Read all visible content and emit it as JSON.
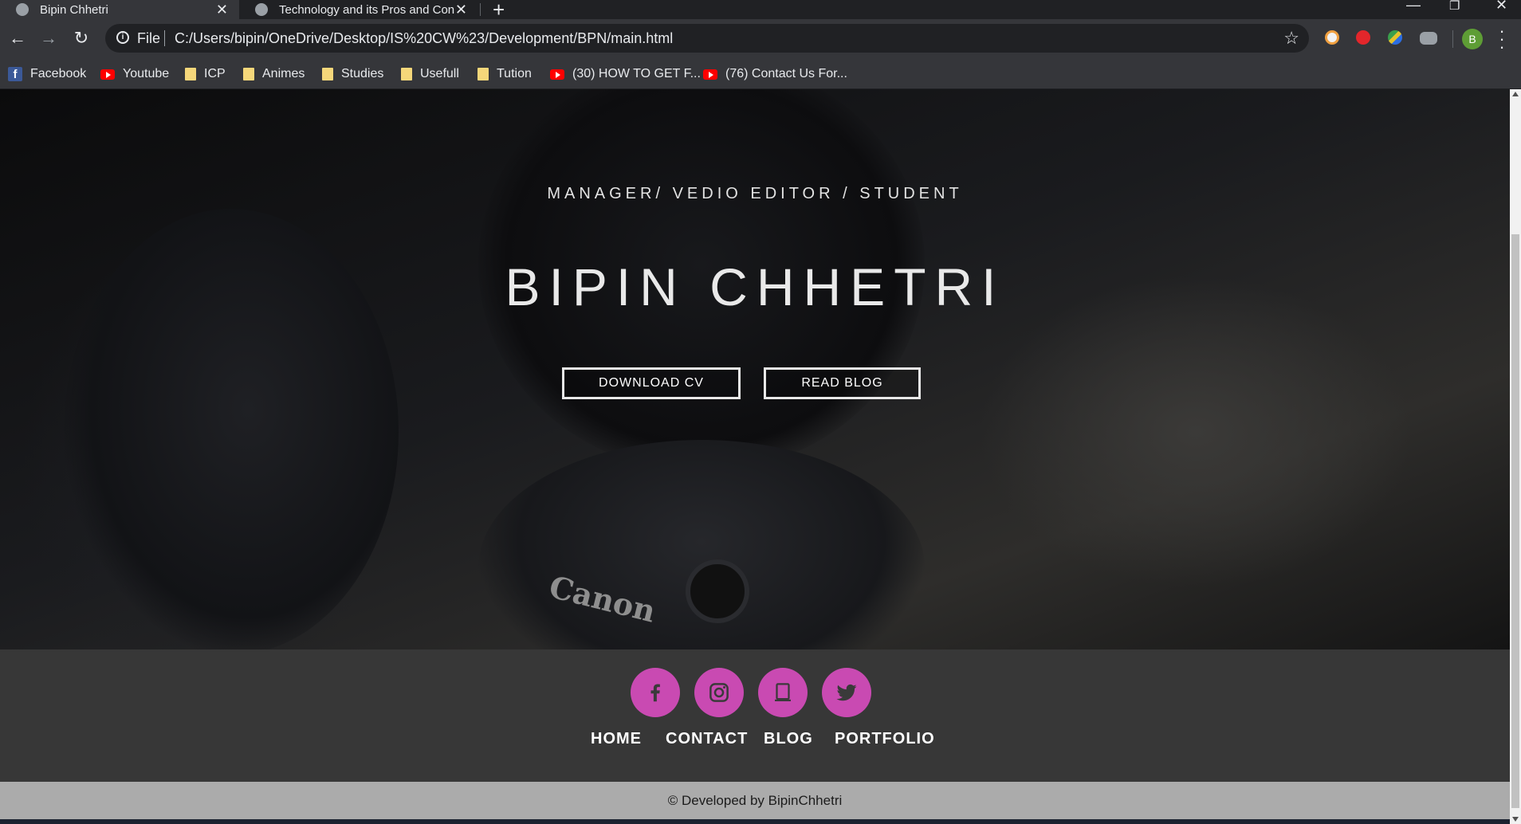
{
  "browser": {
    "tabs": [
      {
        "title": "Bipin Chhetri",
        "active": true
      },
      {
        "title": "Technology and its Pros and Cons",
        "active": false
      }
    ],
    "new_tab_label": "+",
    "window_controls": {
      "minimize": "—",
      "restore": "❐",
      "close": "✕"
    },
    "address": {
      "scheme": "File",
      "url": "C:/Users/bipin/OneDrive/Desktop/IS%20CW%23/Development/BPN/main.html"
    },
    "profile_initial": "B",
    "bookmarks": [
      {
        "label": "Facebook",
        "icon": "facebook-icon"
      },
      {
        "label": "Youtube",
        "icon": "youtube-icon"
      },
      {
        "label": "ICP",
        "icon": "folder-icon"
      },
      {
        "label": "Animes",
        "icon": "folder-icon"
      },
      {
        "label": "Studies",
        "icon": "folder-icon"
      },
      {
        "label": "Usefull",
        "icon": "folder-icon"
      },
      {
        "label": "Tution",
        "icon": "folder-icon"
      },
      {
        "label": "(30) HOW TO GET F...",
        "icon": "youtube-icon"
      },
      {
        "label": "(76) Contact Us For...",
        "icon": "youtube-icon"
      }
    ]
  },
  "hero": {
    "subtitle": "MANAGER/ VEDIO EDITOR / STUDENT",
    "name": "BIPIN CHHETRI",
    "buttons": {
      "download_cv": "DOWNLOAD CV",
      "read_blog": "READ BLOG"
    },
    "background_text": "Canon"
  },
  "footer": {
    "social": [
      "facebook-icon",
      "instagram-icon",
      "tablet-icon",
      "twitter-icon"
    ],
    "nav": {
      "home": "HOME",
      "contact": "CONTACT",
      "blog": "BLOG",
      "portfolio": "PORTFOLIO"
    },
    "copyright": "© Developed by BipinChhetri"
  },
  "colors": {
    "accent": "#c94ab2",
    "footer_bg": "#373737",
    "copyright_bg": "#ababab"
  }
}
